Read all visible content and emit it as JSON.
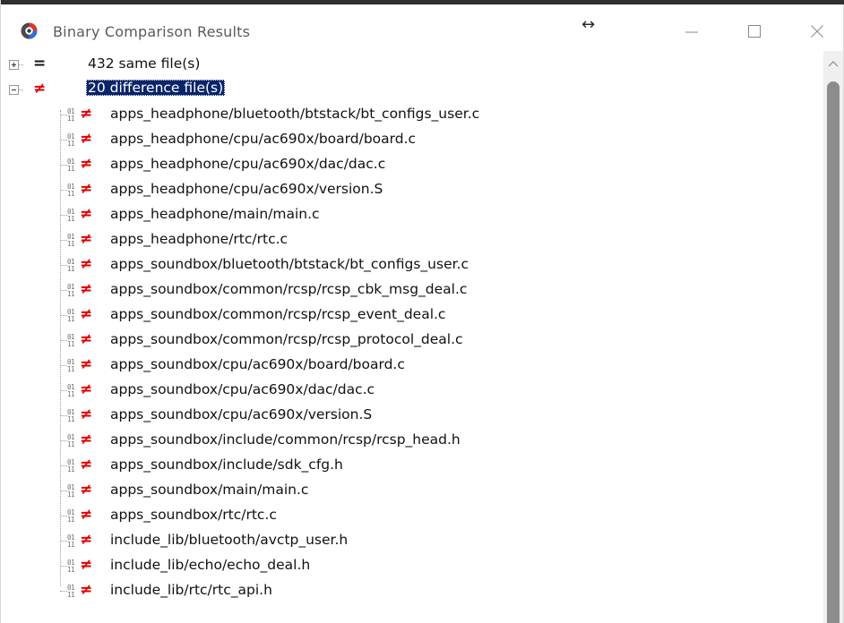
{
  "window": {
    "title": "Binary Comparison Results",
    "resize_glyph": "↔"
  },
  "tree": {
    "groups": [
      {
        "status": "same",
        "symbol": "=",
        "label": "432 same file(s)",
        "expanded": false,
        "selected": false
      },
      {
        "status": "different",
        "symbol": "≠",
        "label": "20 difference file(s)",
        "expanded": true,
        "selected": true
      }
    ],
    "diff_files": [
      {
        "symbol": "≠",
        "path": "apps_headphone/bluetooth/btstack/bt_configs_user.c"
      },
      {
        "symbol": "≠",
        "path": "apps_headphone/cpu/ac690x/board/board.c"
      },
      {
        "symbol": "≠",
        "path": "apps_headphone/cpu/ac690x/dac/dac.c"
      },
      {
        "symbol": "≠",
        "path": "apps_headphone/cpu/ac690x/version.S"
      },
      {
        "symbol": "≠",
        "path": "apps_headphone/main/main.c"
      },
      {
        "symbol": "≠",
        "path": "apps_headphone/rtc/rtc.c"
      },
      {
        "symbol": "≠",
        "path": "apps_soundbox/bluetooth/btstack/bt_configs_user.c"
      },
      {
        "symbol": "≠",
        "path": "apps_soundbox/common/rcsp/rcsp_cbk_msg_deal.c"
      },
      {
        "symbol": "≠",
        "path": "apps_soundbox/common/rcsp/rcsp_event_deal.c"
      },
      {
        "symbol": "≠",
        "path": "apps_soundbox/common/rcsp/rcsp_protocol_deal.c"
      },
      {
        "symbol": "≠",
        "path": "apps_soundbox/cpu/ac690x/board/board.c"
      },
      {
        "symbol": "≠",
        "path": "apps_soundbox/cpu/ac690x/dac/dac.c"
      },
      {
        "symbol": "≠",
        "path": "apps_soundbox/cpu/ac690x/version.S"
      },
      {
        "symbol": "≠",
        "path": "apps_soundbox/include/common/rcsp/rcsp_head.h"
      },
      {
        "symbol": "≠",
        "path": "apps_soundbox/include/sdk_cfg.h"
      },
      {
        "symbol": "≠",
        "path": "apps_soundbox/main/main.c"
      },
      {
        "symbol": "≠",
        "path": "apps_soundbox/rtc/rtc.c"
      },
      {
        "symbol": "≠",
        "path": "include_lib/bluetooth/avctp_user.h"
      },
      {
        "symbol": "≠",
        "path": "include_lib/echo/echo_deal.h"
      },
      {
        "symbol": "≠",
        "path": "include_lib/rtc/rtc_api.h"
      }
    ],
    "binary_icon_glyph": "01\n11"
  },
  "colors": {
    "selection_bg": "#0a246a",
    "diff_symbol": "#e00000",
    "same_symbol": "#111111",
    "scroll_thumb": "#8c8c8c"
  },
  "icons": {
    "app": "comparison-app-icon",
    "minimize": "minimize-icon",
    "maximize": "maximize-icon",
    "close": "close-icon",
    "scroll_up": "chevron-up-icon",
    "file": "binary-file-icon"
  }
}
